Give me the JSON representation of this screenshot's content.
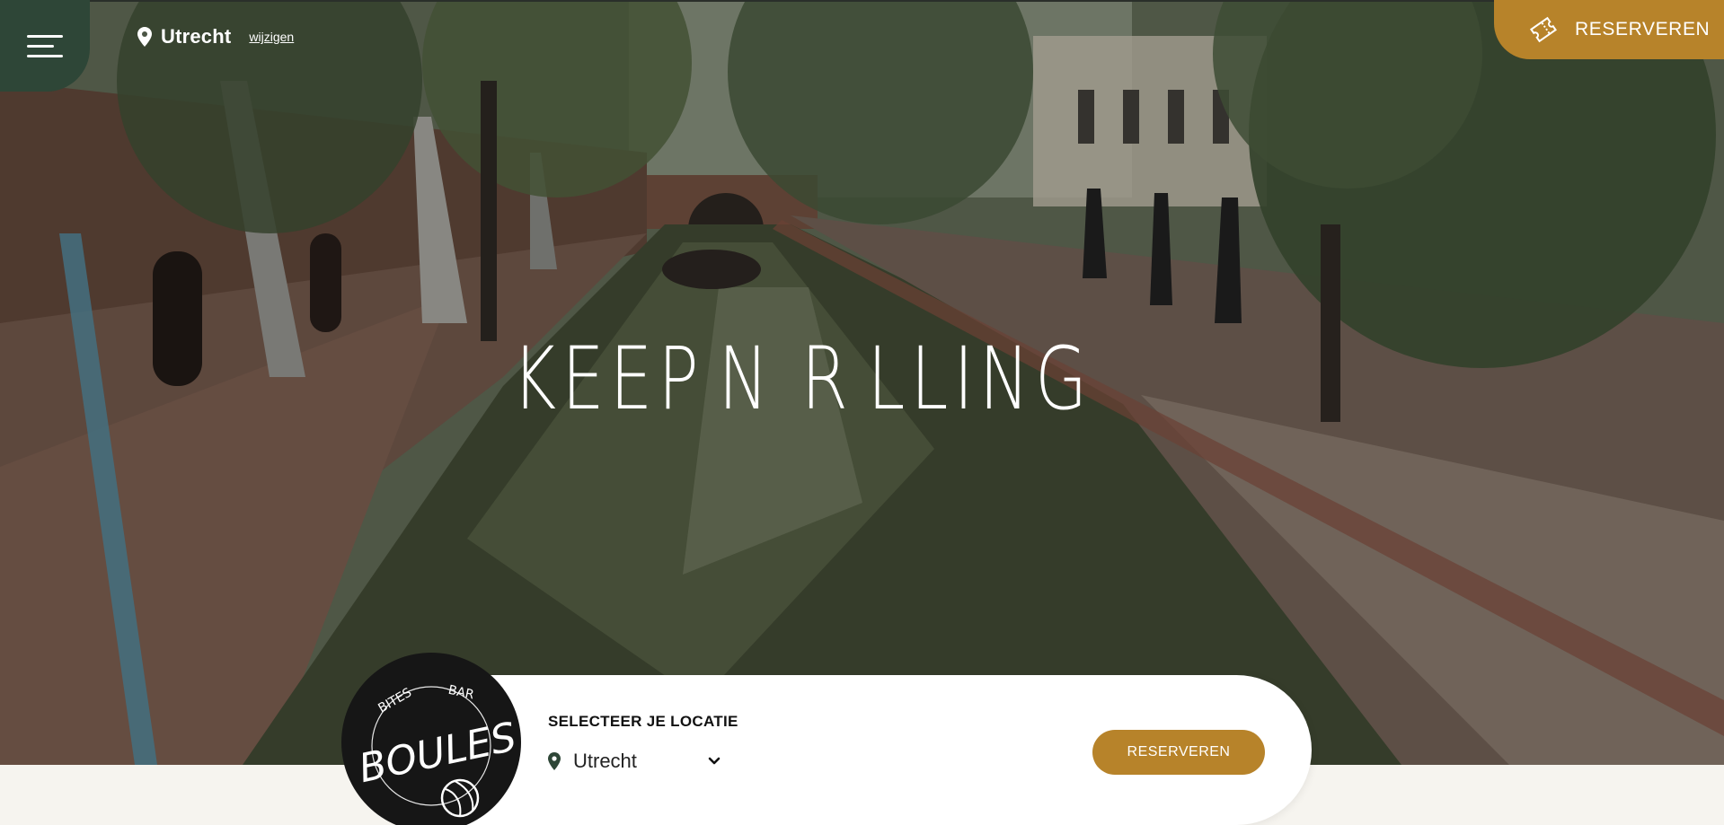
{
  "header": {
    "menu_icon": "hamburger-menu-icon",
    "location_city": "Utrecht",
    "change_location_link": "wijzigen",
    "reserve_button_label": "RESERVEREN",
    "reserve_icon": "ticket-icon"
  },
  "hero": {
    "headline_part1": "KEEP ",
    "headline_o1": "N R",
    "headline_part3": "LLING"
  },
  "brand": {
    "logo_top_left": "BITES",
    "logo_top_right": "BAR",
    "logo_name": "BOULES"
  },
  "location_card": {
    "title": "SELECTEER JE LOCATIE",
    "selected_location": "Utrecht",
    "reserve_button_label": "RESERVEREN"
  },
  "colors": {
    "accent_gold": "#b7832a",
    "menu_green": "#2e4637",
    "cream": "#f6f4ef"
  }
}
